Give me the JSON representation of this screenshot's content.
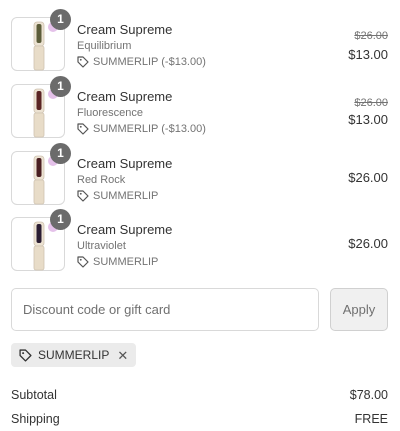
{
  "line_items": [
    {
      "name": "Cream Supreme",
      "variant": "Equilibrium",
      "quantity": "1",
      "discount": "SUMMERLIP (-$13.00)",
      "original_price": "$26.00",
      "price": "$13.00",
      "product_color": "#5c5d3a"
    },
    {
      "name": "Cream Supreme",
      "variant": "Fluorescence",
      "quantity": "1",
      "discount": "SUMMERLIP (-$13.00)",
      "original_price": "$26.00",
      "price": "$13.00",
      "product_color": "#5a2424"
    },
    {
      "name": "Cream Supreme",
      "variant": "Red Rock",
      "quantity": "1",
      "discount": "SUMMERLIP",
      "original_price": "",
      "price": "$26.00",
      "product_color": "#4a1f22"
    },
    {
      "name": "Cream Supreme",
      "variant": "Ultraviolet",
      "quantity": "1",
      "discount": "SUMMERLIP",
      "original_price": "",
      "price": "$26.00",
      "product_color": "#2a1d33"
    }
  ],
  "discount_field": {
    "placeholder": "Discount code or gift card",
    "value": ""
  },
  "apply_label": "Apply",
  "applied_code": {
    "code": "SUMMERLIP",
    "remove_icon": "close-icon"
  },
  "summary": {
    "subtotal_label": "Subtotal",
    "subtotal_value": "$78.00",
    "shipping_label": "Shipping",
    "shipping_value": "FREE"
  },
  "colors": {
    "badge": "#6b6b6b",
    "muted_text": "#737373",
    "border": "#d9d9d9",
    "chip_bg": "#ebebeb"
  }
}
